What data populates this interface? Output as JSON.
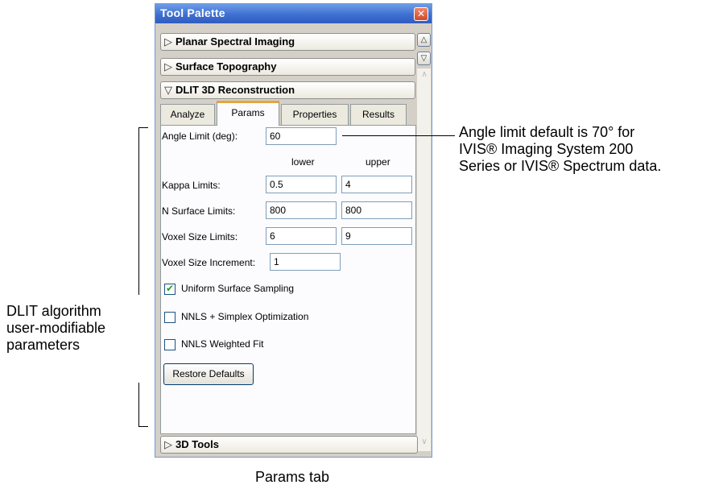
{
  "window": {
    "title": "Tool Palette",
    "close_glyph": "✕"
  },
  "sections": {
    "planar": "Planar Spectral Imaging",
    "surface": "Surface Topography",
    "dlit": "DLIT 3D Reconstruction",
    "tools": "3D Tools"
  },
  "icons": {
    "collapsed": "▷",
    "expanded": "▽"
  },
  "tabs": {
    "analyze": "Analyze",
    "params": "Params",
    "properties": "Properties",
    "results": "Results"
  },
  "params": {
    "angle_label": "Angle Limit (deg):",
    "angle_value": "60",
    "lower_header": "lower",
    "upper_header": "upper",
    "kappa_label": "Kappa Limits:",
    "kappa_lower": "0.5",
    "kappa_upper": "4",
    "nsurf_label": "N Surface Limits:",
    "nsurf_lower": "800",
    "nsurf_upper": "800",
    "voxel_label": "Voxel Size Limits:",
    "voxel_lower": "6",
    "voxel_upper": "9",
    "voxel_inc_label": "Voxel Size Increment:",
    "voxel_inc_value": "1",
    "uniform_label": "Uniform Surface Sampling",
    "uniform_checked": true,
    "nnls_simplex_label": "NNLS + Simplex Optimization",
    "nnls_simplex_checked": false,
    "nnls_weighted_label": "NNLS Weighted Fit",
    "nnls_weighted_checked": false,
    "restore_label": "Restore Defaults"
  },
  "annotations": {
    "angle_note_line1": "Angle limit default is 70° for",
    "angle_note_line2": "IVIS® Imaging System 200",
    "angle_note_line3": "Series or IVIS® Spectrum data.",
    "left_note_line1": "DLIT algorithm",
    "left_note_line2": "user-modifiable",
    "left_note_line3": "parameters",
    "caption": "Params tab"
  },
  "colors": {
    "title_bar": "#3f6fd0",
    "active_tab_accent": "#e5a43b",
    "check_mark": "#21a121"
  }
}
